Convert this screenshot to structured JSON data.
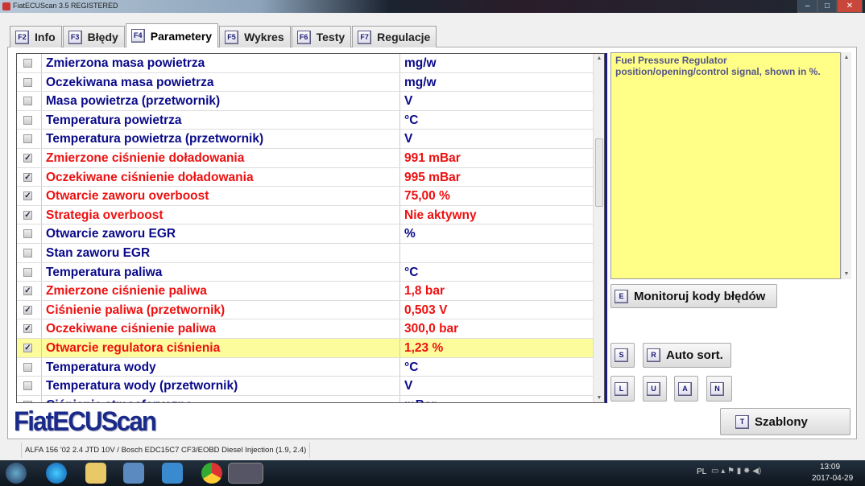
{
  "window": {
    "title": "FiatECUScan 3.5 REGISTERED"
  },
  "tabs": [
    {
      "key": "F2",
      "label": "Info"
    },
    {
      "key": "F3",
      "label": "Błędy"
    },
    {
      "key": "F4",
      "label": "Parametery"
    },
    {
      "key": "F5",
      "label": "Wykres"
    },
    {
      "key": "F6",
      "label": "Testy"
    },
    {
      "key": "F7",
      "label": "Regulacje"
    }
  ],
  "params": [
    {
      "name": "Zmierzona masa powietrza",
      "value": "mg/w",
      "checked": false,
      "color": "blue"
    },
    {
      "name": "Oczekiwana masa powietrza",
      "value": "mg/w",
      "checked": false,
      "color": "blue"
    },
    {
      "name": "Masa powietrza (przetwornik)",
      "value": "V",
      "checked": false,
      "color": "blue"
    },
    {
      "name": "Temperatura powietrza",
      "value": "°C",
      "checked": false,
      "color": "blue"
    },
    {
      "name": "Temperatura powietrza (przetwornik)",
      "value": "V",
      "checked": false,
      "color": "blue"
    },
    {
      "name": "Zmierzone ciśnienie doładowania",
      "value": "991 mBar",
      "checked": true,
      "color": "red"
    },
    {
      "name": "Oczekiwane ciśnienie doładowania",
      "value": "995 mBar",
      "checked": true,
      "color": "red"
    },
    {
      "name": "Otwarcie zaworu overboost",
      "value": "75,00 %",
      "checked": true,
      "color": "red"
    },
    {
      "name": "Strategia overboost",
      "value": "Nie aktywny",
      "checked": true,
      "color": "red"
    },
    {
      "name": "Otwarcie zaworu EGR",
      "value": "%",
      "checked": false,
      "color": "blue"
    },
    {
      "name": "Stan zaworu EGR",
      "value": "",
      "checked": false,
      "color": "blue"
    },
    {
      "name": "Temperatura paliwa",
      "value": "°C",
      "checked": false,
      "color": "blue"
    },
    {
      "name": "Zmierzone ciśnienie paliwa",
      "value": "1,8 bar",
      "checked": true,
      "color": "red"
    },
    {
      "name": "Ciśnienie paliwa (przetwornik)",
      "value": "0,503 V",
      "checked": true,
      "color": "red"
    },
    {
      "name": "Oczekiwane ciśnienie paliwa",
      "value": "300,0 bar",
      "checked": true,
      "color": "red"
    },
    {
      "name": "Otwarcie regulatora ciśnienia",
      "value": "1,23 %",
      "checked": true,
      "color": "red",
      "selected": true
    },
    {
      "name": "Temperatura wody",
      "value": "°C",
      "checked": false,
      "color": "blue"
    },
    {
      "name": "Temperatura wody (przetwornik)",
      "value": "V",
      "checked": false,
      "color": "blue"
    },
    {
      "name": "Ciśnienie atmosferyczne",
      "value": "mBar",
      "checked": false,
      "color": "blue"
    }
  ],
  "description": "Fuel Pressure Regulator position/opening/control signal, shown in %.",
  "buttons": {
    "monitor": {
      "key": "E",
      "label": "Monitoruj kody błędów"
    },
    "s": {
      "key": "S"
    },
    "autosort": {
      "key": "R",
      "label": "Auto sort."
    },
    "l": {
      "key": "L"
    },
    "u": {
      "key": "U"
    },
    "a": {
      "key": "A"
    },
    "n": {
      "key": "N"
    },
    "templates": {
      "key": "T",
      "label": "Szablony"
    }
  },
  "logo": "FiatECUScan",
  "status": "ALFA 156 '02 2.4 JTD 10V / Bosch EDC15C7 CF3/EOBD Diesel Injection (1.9, 2.4)",
  "tray": {
    "lang": "PL",
    "time": "13:09",
    "date": "2017-04-29"
  },
  "colors": {
    "blue": "#0a0a8a",
    "red": "#ee1010",
    "highlight": "#fcfc9c",
    "desc_bg": "#ffff88"
  }
}
